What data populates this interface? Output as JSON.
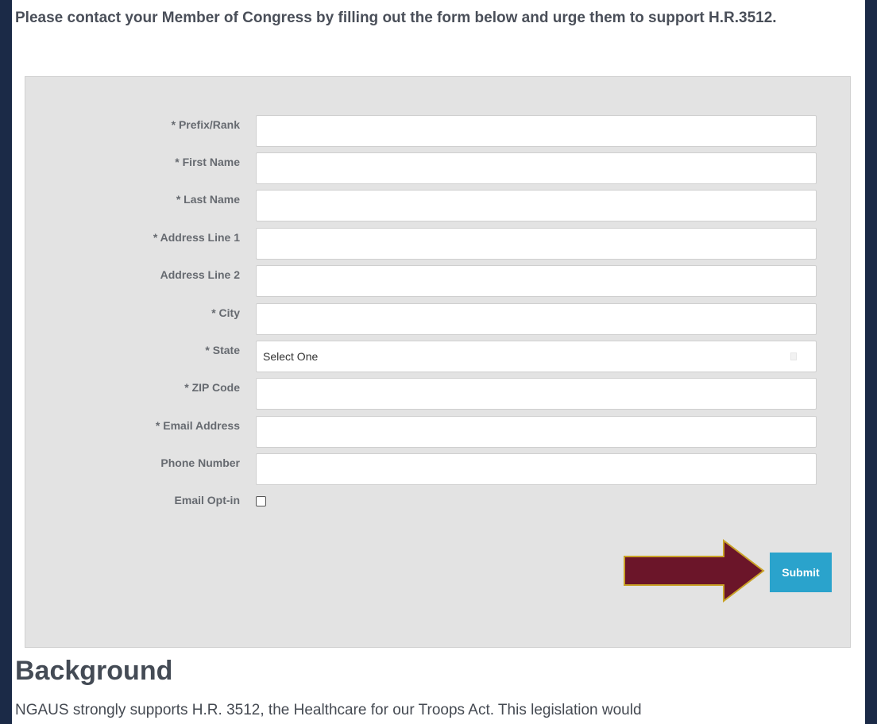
{
  "intro": {
    "text": "Please contact your Member of Congress by filling out the form below and urge them to support H.R.3512."
  },
  "form": {
    "fields": [
      {
        "label": "* Prefix/Rank",
        "value": ""
      },
      {
        "label": "* First Name",
        "value": ""
      },
      {
        "label": "* Last Name",
        "value": ""
      },
      {
        "label": "* Address Line 1",
        "value": ""
      },
      {
        "label": "Address Line 2",
        "value": ""
      },
      {
        "label": "* City",
        "value": ""
      },
      {
        "label": "* State",
        "value": "Select One"
      },
      {
        "label": "* ZIP Code",
        "value": ""
      },
      {
        "label": "* Email Address",
        "value": ""
      },
      {
        "label": "Phone Number",
        "value": ""
      },
      {
        "label": "Email Opt-in",
        "checked": false
      }
    ],
    "submit_label": "Submit",
    "arrow_color": "#6b1529",
    "arrow_border_color": "#c9a227",
    "button_color": "#2aa3cc"
  },
  "background": {
    "heading": "Background",
    "text": "NGAUS strongly supports H.R. 3512, the Healthcare for our Troops Act. This legislation would"
  }
}
